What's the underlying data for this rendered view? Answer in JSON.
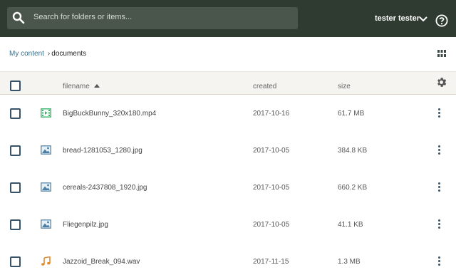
{
  "search": {
    "placeholder": "Search for folders or items..."
  },
  "user": {
    "name": "tester tester"
  },
  "breadcrumb": {
    "root": "My content",
    "separator": "›",
    "current": "documents"
  },
  "table": {
    "headers": {
      "filename": "filename",
      "created": "created",
      "size": "size"
    },
    "rows": [
      {
        "name": "BigBuckBunny_320x180.mp4",
        "created": "2017-10-16",
        "size": "61.7 MB",
        "icon": "video-file-icon"
      },
      {
        "name": "bread-1281053_1280.jpg",
        "created": "2017-10-05",
        "size": "384.8 KB",
        "icon": "image-file-icon"
      },
      {
        "name": "cereals-2437808_1920.jpg",
        "created": "2017-10-05",
        "size": "660.2 KB",
        "icon": "image-file-icon"
      },
      {
        "name": "Fliegenpilz.jpg",
        "created": "2017-10-05",
        "size": "41.1 KB",
        "icon": "image-file-icon"
      },
      {
        "name": "Jazzoid_Break_094.wav",
        "created": "2017-11-15",
        "size": "1.3 MB",
        "icon": "audio-file-icon"
      }
    ]
  },
  "colors": {
    "topbar": "#2f3b31",
    "search_bg": "#4a564c",
    "accent": "#37536a",
    "video_icon": "#3db36c",
    "image_icon": "#4a7fa3",
    "audio_icon": "#e08a2e"
  }
}
